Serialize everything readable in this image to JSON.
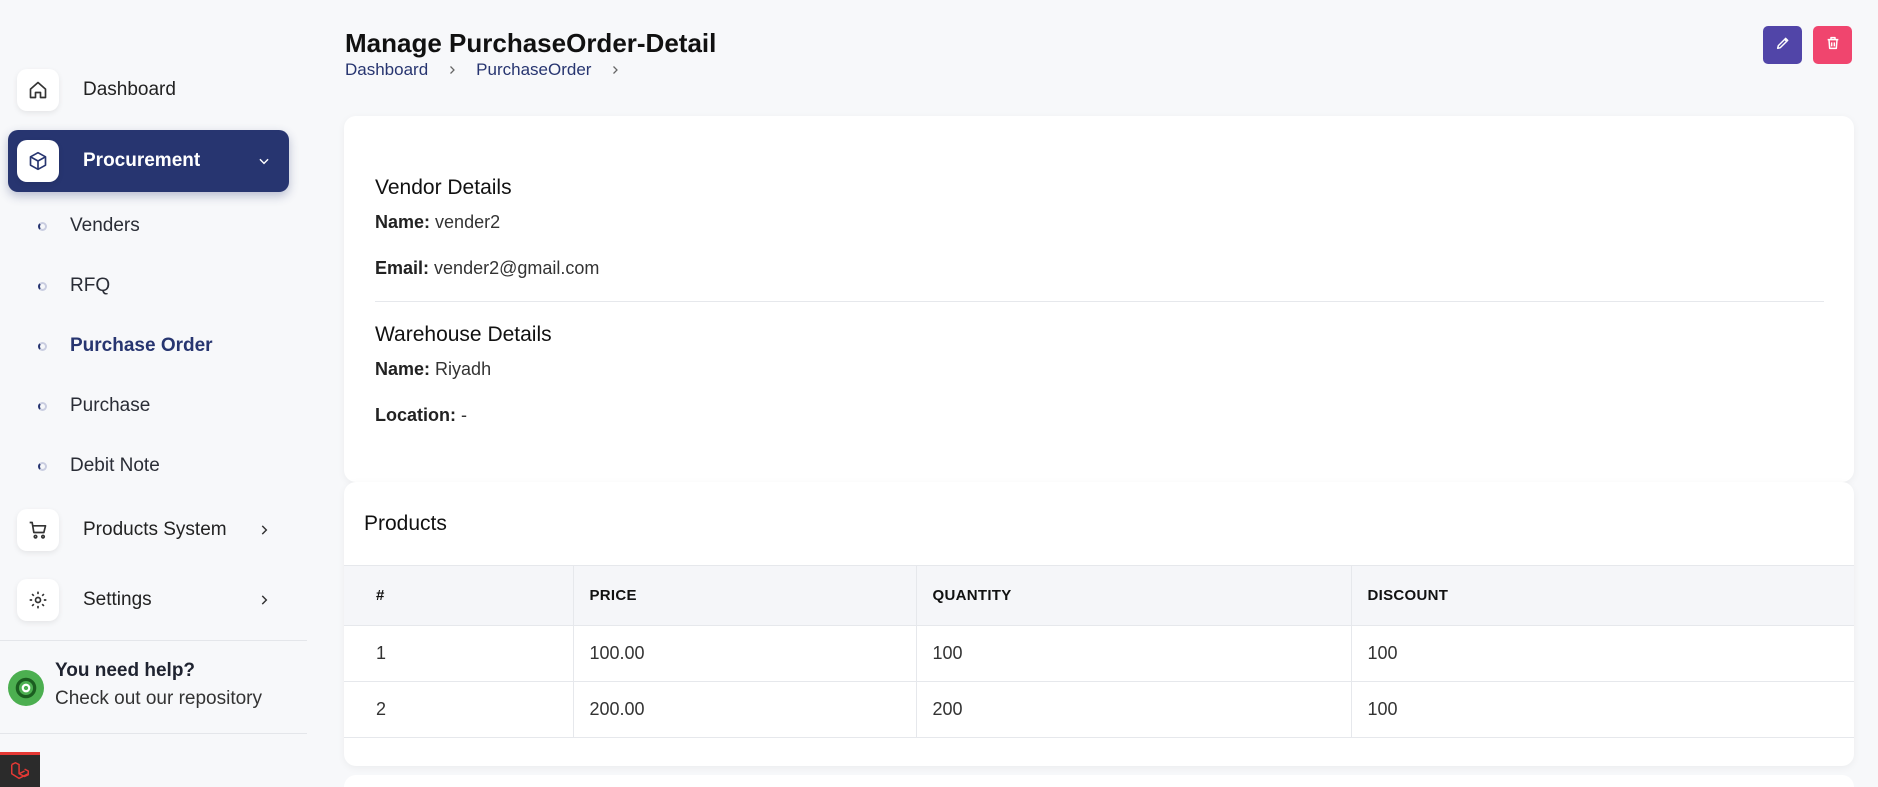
{
  "sidebar": {
    "dashboard": {
      "label": "Dashboard",
      "icon": "home-icon"
    },
    "procurement": {
      "label": "Procurement",
      "icon": "cube-icon"
    },
    "sub_items": [
      {
        "label": "Venders"
      },
      {
        "label": "RFQ"
      },
      {
        "label": "Purchase Order"
      },
      {
        "label": "Purchase"
      },
      {
        "label": "Debit Note"
      }
    ],
    "products_system": {
      "label": "Products System",
      "icon": "cart-icon"
    },
    "settings": {
      "label": "Settings",
      "icon": "gear-icon"
    },
    "help": {
      "title": "You need help?",
      "subtitle": "Check out our repository",
      "icon": "lifebuoy-icon"
    }
  },
  "header": {
    "title": "Manage PurchaseOrder-Detail",
    "breadcrumb": [
      "Dashboard",
      "PurchaseOrder"
    ],
    "edit_icon": "pencil-icon",
    "delete_icon": "trash-icon"
  },
  "vendor": {
    "section_title": "Vendor Details",
    "name_key": "Name:",
    "name_value": "vender2",
    "email_key": "Email:",
    "email_value": "vender2@gmail.com"
  },
  "warehouse": {
    "section_title": "Warehouse Details",
    "name_key": "Name:",
    "name_value": "Riyadh",
    "location_key": "Location:",
    "location_value": "-"
  },
  "products": {
    "title": "Products",
    "columns": [
      "#",
      "PRICE",
      "QUANTITY",
      "DISCOUNT"
    ],
    "rows": [
      [
        "1",
        "100.00",
        "100",
        "100"
      ],
      [
        "2",
        "200.00",
        "200",
        "100"
      ]
    ]
  },
  "colors": {
    "primary": "#273570",
    "edit_button": "#5145a8",
    "delete_button": "#f0456e",
    "help_icon": "#4caf50"
  }
}
